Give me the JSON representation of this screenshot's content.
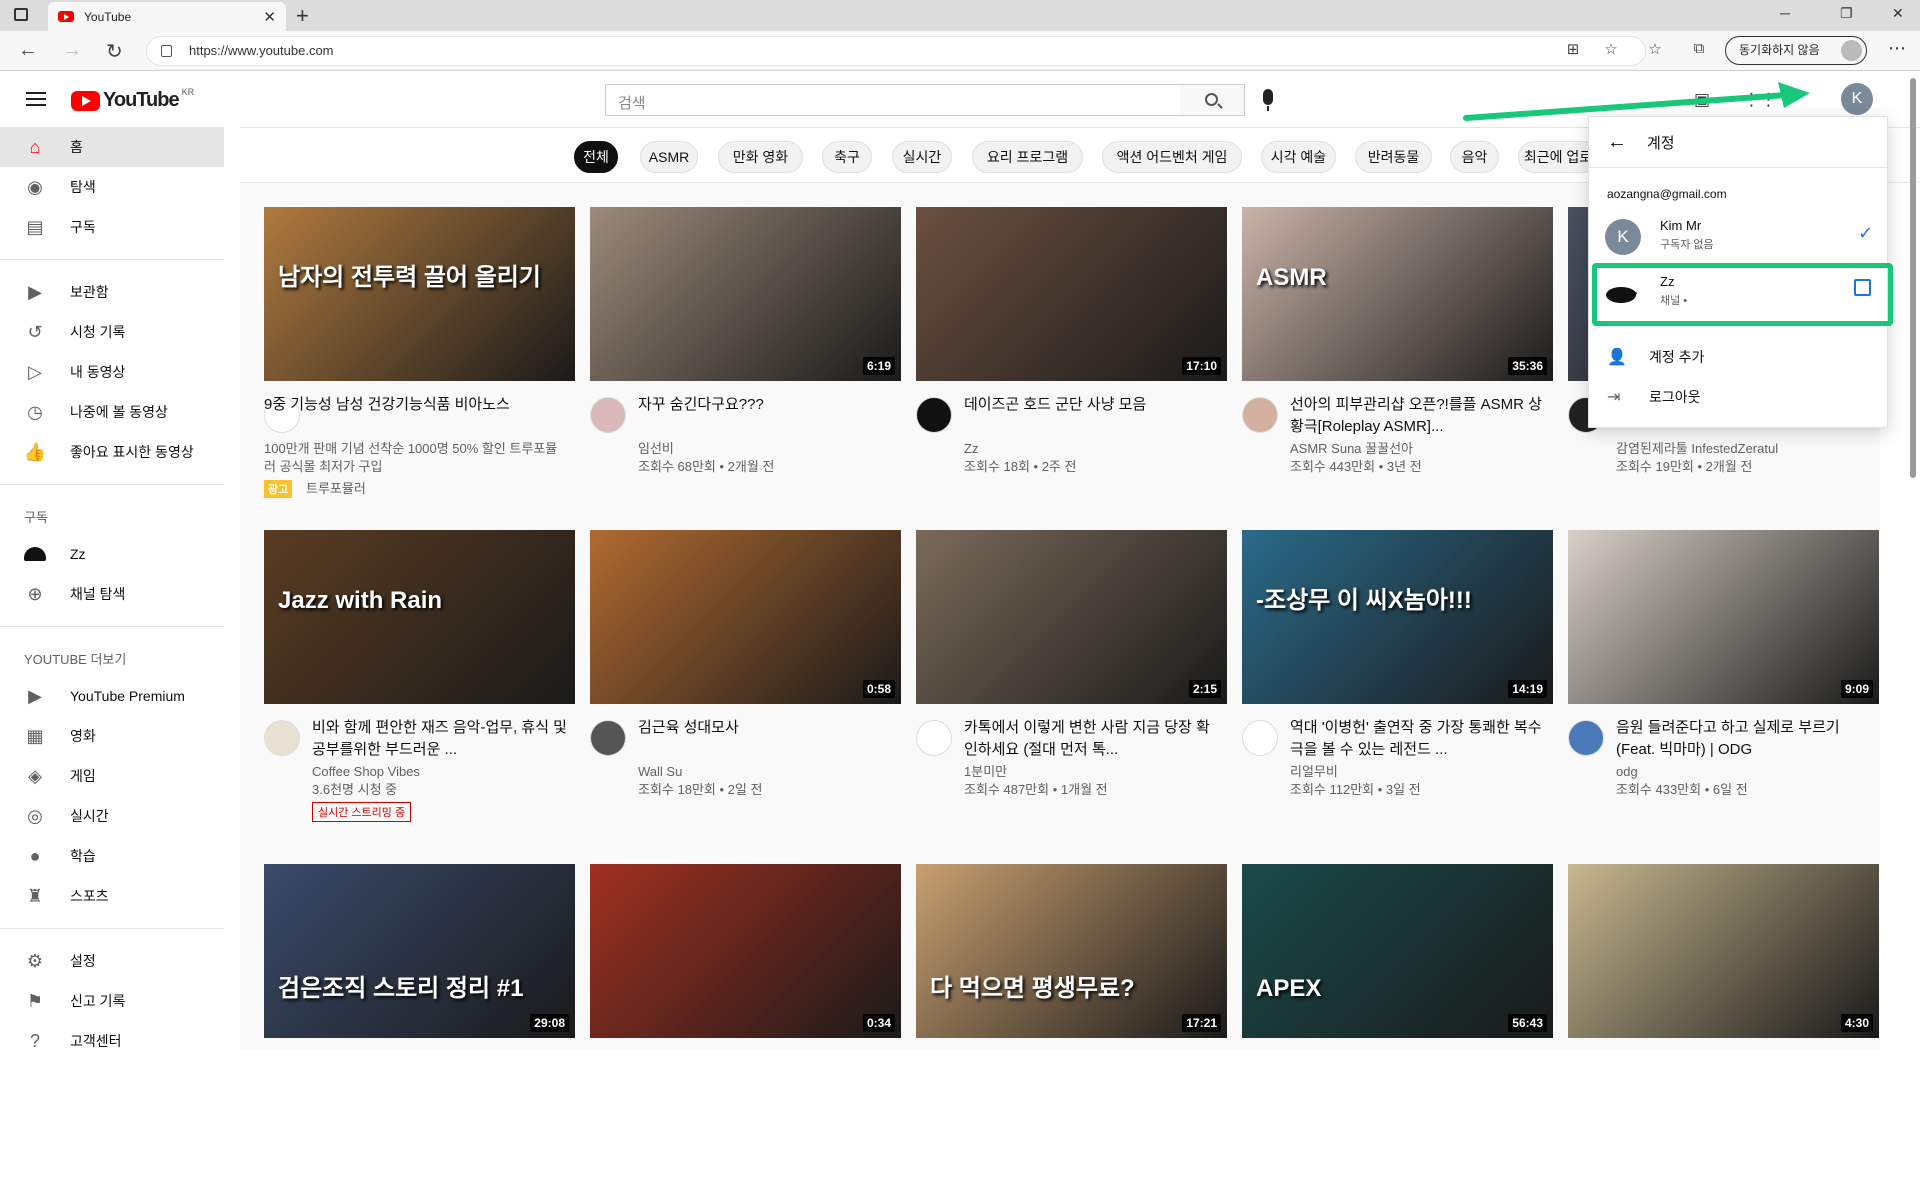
{
  "browser": {
    "tab_title": "YouTube",
    "url": "https://www.youtube.com",
    "sync_label": "동기화하지 않음"
  },
  "header": {
    "logo_text": "YouTube",
    "region": "KR",
    "search_placeholder": "검색",
    "avatar_letter": "K"
  },
  "sidebar": {
    "main": [
      {
        "label": "홈",
        "icon": "home-icon"
      },
      {
        "label": "탐색",
        "icon": "compass-icon"
      },
      {
        "label": "구독",
        "icon": "subscriptions-icon"
      }
    ],
    "library": [
      {
        "label": "보관함",
        "icon": "library-icon"
      },
      {
        "label": "시청 기록",
        "icon": "history-icon"
      },
      {
        "label": "내 동영상",
        "icon": "my-videos-icon"
      },
      {
        "label": "나중에 볼 동영상",
        "icon": "watch-later-icon"
      },
      {
        "label": "좋아요 표시한 동영상",
        "icon": "liked-icon"
      }
    ],
    "subs_header": "구독",
    "subs": [
      {
        "label": "Zz",
        "icon": "channel-avatar"
      },
      {
        "label": "채널 탐색",
        "icon": "browse-channels-icon"
      }
    ],
    "more_header": "YOUTUBE 더보기",
    "more": [
      {
        "label": "YouTube Premium",
        "icon": "premium-icon"
      },
      {
        "label": "영화",
        "icon": "movies-icon"
      },
      {
        "label": "게임",
        "icon": "gaming-icon"
      },
      {
        "label": "실시간",
        "icon": "live-icon"
      },
      {
        "label": "학습",
        "icon": "learning-icon"
      },
      {
        "label": "스포츠",
        "icon": "sports-icon"
      }
    ],
    "settings": [
      {
        "label": "설정",
        "icon": "settings-icon"
      },
      {
        "label": "신고 기록",
        "icon": "flag-icon"
      },
      {
        "label": "고객센터",
        "icon": "help-icon"
      }
    ]
  },
  "chips": [
    "전체",
    "ASMR",
    "만화 영화",
    "축구",
    "실시간",
    "요리 프로그램",
    "액션 어드벤처 게임",
    "시각 예술",
    "반려동물",
    "음악",
    "최근에 업로"
  ],
  "videos": [
    {
      "title": "9중 기능성 남성 건강기능식품 비아노스",
      "channel": "트루포뮬러",
      "views": "",
      "ago": "",
      "duration": "",
      "desc": "100만개 판매 기념 선착순 1000명 50% 할인 트루포뮬러 공식몰 최저가 구입",
      "ad": "광고",
      "thumb": "#b07a3e",
      "avatar": "#ffffff",
      "thumb_text": "남자의 전투력 끌어 올리기"
    },
    {
      "title": "자꾸 숨긴다구요???",
      "channel": "임선비",
      "views": "조회수 68만회",
      "ago": "2개월 전",
      "duration": "6:19",
      "thumb": "#9c8a7a",
      "avatar": "#d8b8b8"
    },
    {
      "title": "데이즈곤 호드 군단 사냥 모음",
      "channel": "Zz",
      "views": "조회수 18회",
      "ago": "2주 전",
      "duration": "17:10",
      "thumb": "#6b5040",
      "avatar": "#111111"
    },
    {
      "title": "선아의 피부관리샵 오픈?!를플 ASMR 상황극[Roleplay ASMR]...",
      "channel": "ASMR Suna 꿀꿀선아",
      "views": "조회수 443만회",
      "ago": "3년 전",
      "duration": "35:36",
      "thumb": "#c9b3a8",
      "avatar": "#d4b0a0",
      "thumb_text": "ASMR"
    },
    {
      "title": "",
      "channel": "감염된제라툴 InfestedZeratul",
      "views": "조회수 19만회",
      "ago": "2개월 전",
      "duration": "",
      "thumb": "#4a5060",
      "avatar": "#222222"
    },
    {
      "title": "비와 함께 편안한 재즈 음악-업무, 휴식 및 공부를위한 부드러운 ...",
      "channel": "Coffee Shop Vibes",
      "views": "3.6천명 시청 중",
      "ago": "",
      "duration": "",
      "live": "실시간 스트리밍 중",
      "thumb": "#5a3c22",
      "avatar": "#e8e0d0",
      "thumb_text": "Jazz with Rain"
    },
    {
      "title": "김근육 성대모사",
      "channel": "Wall Su",
      "views": "조회수 18만회",
      "ago": "2일 전",
      "duration": "0:58",
      "thumb": "#b06a30",
      "avatar": "#555555"
    },
    {
      "title": "카톡에서 이렇게 변한 사람 지금 당장 확인하세요 (절대 먼저 톡...",
      "channel": "1분미만",
      "views": "조회수 487만회",
      "ago": "1개월 전",
      "duration": "2:15",
      "thumb": "#7a6a5a",
      "avatar": "#ffffff"
    },
    {
      "title": "역대 '이병헌' 출연작 중 가장 통쾌한 복수극을 볼 수 있는 레전드 ...",
      "channel": "리얼무비",
      "views": "조회수 112만회",
      "ago": "3일 전",
      "duration": "14:19",
      "thumb": "#2a6a8a",
      "avatar": "#ffffff",
      "thumb_text": "-조상무 이 씨X놈아!!!"
    },
    {
      "title": "음원 들려준다고 하고 실제로 부르기 (Feat. 빅마마) | ODG",
      "channel": "odg",
      "views": "조회수 433만회",
      "ago": "6일 전",
      "duration": "9:09",
      "thumb": "#d8d0c8",
      "avatar": "#4a7ab8"
    },
    {
      "title": "",
      "channel": "",
      "views": "",
      "ago": "",
      "duration": "29:08",
      "thumb": "#3a4a6a",
      "thumb_text": "검은조직 스토리 정리 #1"
    },
    {
      "title": "",
      "channel": "",
      "views": "",
      "ago": "",
      "duration": "0:34",
      "thumb": "#a03020"
    },
    {
      "title": "",
      "channel": "",
      "views": "",
      "ago": "",
      "duration": "17:21",
      "thumb": "#c8a070",
      "thumb_text": "다 먹으면 평생무료?"
    },
    {
      "title": "",
      "channel": "",
      "views": "",
      "ago": "",
      "duration": "56:43",
      "thumb": "#1a4a4a",
      "thumb_text": "APEX"
    },
    {
      "title": "",
      "channel": "",
      "views": "",
      "ago": "",
      "duration": "4:30",
      "thumb": "#c8b890"
    }
  ],
  "account_menu": {
    "title": "계정",
    "email": "aozangna@gmail.com",
    "accounts": [
      {
        "name": "Kim Mr",
        "sub": "구독자 없음",
        "letter": "K",
        "color": "#7b8a9a",
        "selected": true
      },
      {
        "name": "Zz",
        "sub": "채널 •",
        "letter": "",
        "color": "#ffffff",
        "selected": false
      }
    ],
    "add_account": "계정 추가",
    "logout": "로그아웃"
  },
  "colors": {
    "highlight": "#18c77a",
    "youtube_red": "#ff0000",
    "link_blue": "#1a73e8"
  }
}
